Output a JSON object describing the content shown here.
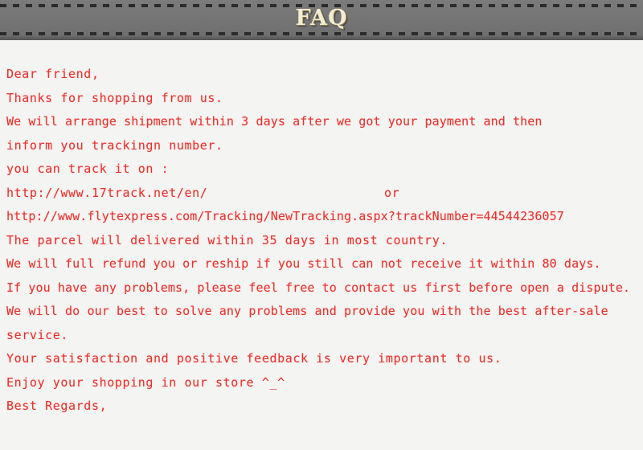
{
  "banner": {
    "title": "FAQ",
    "background_color": "#757575",
    "title_color": "#f2ecd2",
    "dash_color": "#2b2b2b"
  },
  "page": {
    "background_color": "#f4f4f3",
    "text_color": "#e8332d"
  },
  "body": {
    "lines": [
      {
        "text": "Dear friend,",
        "trailing": ""
      },
      {
        "text": "Thanks for shopping from us.",
        "trailing": ""
      },
      {
        "text": "We will arrange shipment within 3 days after we got your payment and then",
        "trailing": ""
      },
      {
        "text": "inform you trackingn number.",
        "trailing": ""
      },
      {
        "text": "you can track it on :",
        "trailing": ""
      },
      {
        "text": "http://www.17track.net/en/",
        "trailing": "or"
      },
      {
        "text": "http://www.flytexpress.com/Tracking/NewTracking.aspx?trackNumber=44544236057",
        "trailing": ""
      },
      {
        "text": "The parcel will delivered within 35 days in most country.",
        "trailing": ""
      },
      {
        "text": "We will full refund you or reship if you still can not receive it within 80 days.",
        "trailing": ""
      },
      {
        "text": "If you have any problems, please feel free to contact us first before open a dispute.",
        "trailing": ""
      },
      {
        "text": "We will do our best to solve any problems and provide you with the best after-sale",
        "trailing": ""
      },
      {
        "text": "service.",
        "trailing": ""
      },
      {
        "text": "Your satisfaction and positive feedback is very important to us.",
        "trailing": ""
      },
      {
        "text": "Enjoy your shopping in our store ^_^",
        "trailing": ""
      },
      {
        "text": "Best Regards,",
        "trailing": ""
      }
    ]
  }
}
